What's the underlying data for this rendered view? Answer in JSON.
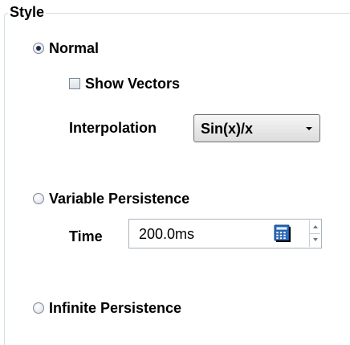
{
  "group": {
    "title": "Style"
  },
  "options": {
    "normal_label": "Normal",
    "show_vectors_label": "Show Vectors",
    "interpolation_label": "Interpolation",
    "interpolation_value": "Sin(x)/x",
    "variable_persistence_label": "Variable Persistence",
    "time_label": "Time",
    "time_value": "200.0ms",
    "infinite_persistence_label": "Infinite Persistence"
  },
  "state": {
    "selected_mode": "Normal",
    "show_vectors_checked": false
  },
  "icons": {
    "calculator": "calculator-icon",
    "dropdown": "chevron-down-icon",
    "spin_up": "spin-up-icon",
    "spin_down": "spin-down-icon"
  },
  "colors": {
    "group_border": "#d5dfe5",
    "radio_dot": "#1b2a44",
    "calculator_accent": "#1e6fd9"
  }
}
